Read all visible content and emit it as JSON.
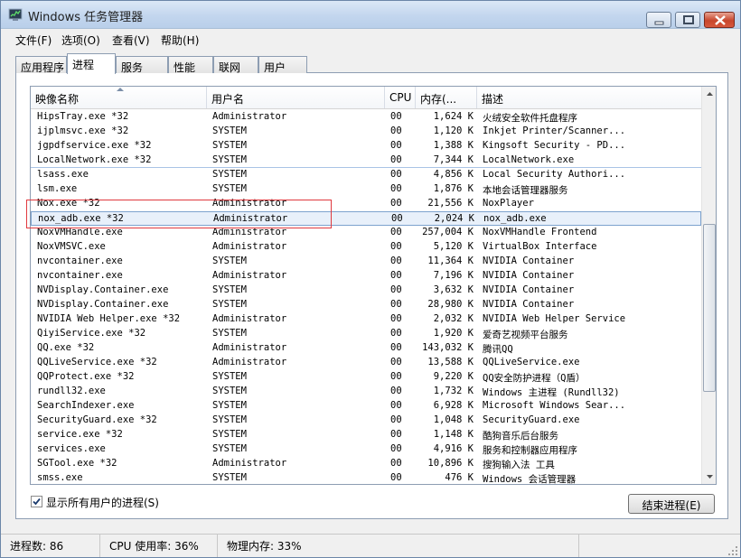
{
  "window": {
    "title": "Windows 任务管理器"
  },
  "menu": [
    {
      "label": "文件(F)"
    },
    {
      "label": "选项(O)"
    },
    {
      "label": "查看(V)"
    },
    {
      "label": "帮助(H)"
    }
  ],
  "tabs": [
    {
      "label": "应用程序"
    },
    {
      "label": "进程",
      "active": true
    },
    {
      "label": "服务"
    },
    {
      "label": "性能"
    },
    {
      "label": "联网"
    },
    {
      "label": "用户"
    }
  ],
  "columns": {
    "name": "映像名称",
    "user": "用户名",
    "cpu": "CPU",
    "mem": "内存(...",
    "desc": "描述"
  },
  "processes": [
    {
      "name": "HipsTray.exe *32",
      "user": "Administrator",
      "cpu": "00",
      "mem": "1,624 K",
      "desc": "火绒安全软件托盘程序"
    },
    {
      "name": "ijplmsvc.exe *32",
      "user": "SYSTEM",
      "cpu": "00",
      "mem": "1,120 K",
      "desc": "Inkjet Printer/Scanner..."
    },
    {
      "name": "jgpdfservice.exe *32",
      "user": "SYSTEM",
      "cpu": "00",
      "mem": "1,388 K",
      "desc": "Kingsoft Security - PD..."
    },
    {
      "name": "LocalNetwork.exe *32",
      "user": "SYSTEM",
      "cpu": "00",
      "mem": "7,344 K",
      "desc": "LocalNetwork.exe"
    },
    {
      "name": "lsass.exe",
      "user": "SYSTEM",
      "cpu": "00",
      "mem": "4,856 K",
      "desc": "Local Security Authori..."
    },
    {
      "name": "lsm.exe",
      "user": "SYSTEM",
      "cpu": "00",
      "mem": "1,876 K",
      "desc": "本地会话管理器服务"
    },
    {
      "name": "Nox.exe *32",
      "user": "Administrator",
      "cpu": "00",
      "mem": "21,556 K",
      "desc": "NoxPlayer"
    },
    {
      "name": "nox_adb.exe *32",
      "user": "Administrator",
      "cpu": "00",
      "mem": "2,024 K",
      "desc": "nox_adb.exe"
    },
    {
      "name": "NoxVMHandle.exe",
      "user": "Administrator",
      "cpu": "00",
      "mem": "257,004 K",
      "desc": "NoxVMHandle Frontend"
    },
    {
      "name": "NoxVMSVC.exe",
      "user": "Administrator",
      "cpu": "00",
      "mem": "5,120 K",
      "desc": "VirtualBox Interface"
    },
    {
      "name": "nvcontainer.exe",
      "user": "SYSTEM",
      "cpu": "00",
      "mem": "11,364 K",
      "desc": "NVIDIA Container"
    },
    {
      "name": "nvcontainer.exe",
      "user": "Administrator",
      "cpu": "00",
      "mem": "7,196 K",
      "desc": "NVIDIA Container"
    },
    {
      "name": "NVDisplay.Container.exe",
      "user": "SYSTEM",
      "cpu": "00",
      "mem": "3,632 K",
      "desc": "NVIDIA Container"
    },
    {
      "name": "NVDisplay.Container.exe",
      "user": "SYSTEM",
      "cpu": "00",
      "mem": "28,980 K",
      "desc": "NVIDIA Container"
    },
    {
      "name": "NVIDIA Web Helper.exe *32",
      "user": "Administrator",
      "cpu": "00",
      "mem": "2,032 K",
      "desc": "NVIDIA Web Helper Service"
    },
    {
      "name": "QiyiService.exe *32",
      "user": "SYSTEM",
      "cpu": "00",
      "mem": "1,920 K",
      "desc": "爱奇艺视频平台服务"
    },
    {
      "name": "QQ.exe *32",
      "user": "Administrator",
      "cpu": "00",
      "mem": "143,032 K",
      "desc": "腾讯QQ"
    },
    {
      "name": "QQLiveService.exe *32",
      "user": "Administrator",
      "cpu": "00",
      "mem": "13,588 K",
      "desc": "QQLiveService.exe"
    },
    {
      "name": "QQProtect.exe *32",
      "user": "SYSTEM",
      "cpu": "00",
      "mem": "9,220 K",
      "desc": "QQ安全防护进程（Q盾）"
    },
    {
      "name": "rundll32.exe",
      "user": "SYSTEM",
      "cpu": "00",
      "mem": "1,732 K",
      "desc": "Windows 主进程 (Rundll32)"
    },
    {
      "name": "SearchIndexer.exe",
      "user": "SYSTEM",
      "cpu": "00",
      "mem": "6,928 K",
      "desc": "Microsoft Windows Sear..."
    },
    {
      "name": "SecurityGuard.exe *32",
      "user": "SYSTEM",
      "cpu": "00",
      "mem": "1,048 K",
      "desc": "SecurityGuard.exe"
    },
    {
      "name": "service.exe *32",
      "user": "SYSTEM",
      "cpu": "00",
      "mem": "1,148 K",
      "desc": "酷狗音乐后台服务"
    },
    {
      "name": "services.exe",
      "user": "SYSTEM",
      "cpu": "00",
      "mem": "4,916 K",
      "desc": "服务和控制器应用程序"
    },
    {
      "name": "SGTool.exe *32",
      "user": "Administrator",
      "cpu": "00",
      "mem": "10,896 K",
      "desc": "搜狗输入法 工具"
    },
    {
      "name": "smss.exe",
      "user": "SYSTEM",
      "cpu": "00",
      "mem": "476 K",
      "desc": "Windows 会话管理器"
    }
  ],
  "show_all_users": {
    "label": "显示所有用户的进程(S)",
    "checked": true
  },
  "end_process_button": "结束进程(E)",
  "status": {
    "processes": "进程数: 86",
    "cpu": "CPU 使用率: 36%",
    "memory": "物理内存: 33%"
  }
}
